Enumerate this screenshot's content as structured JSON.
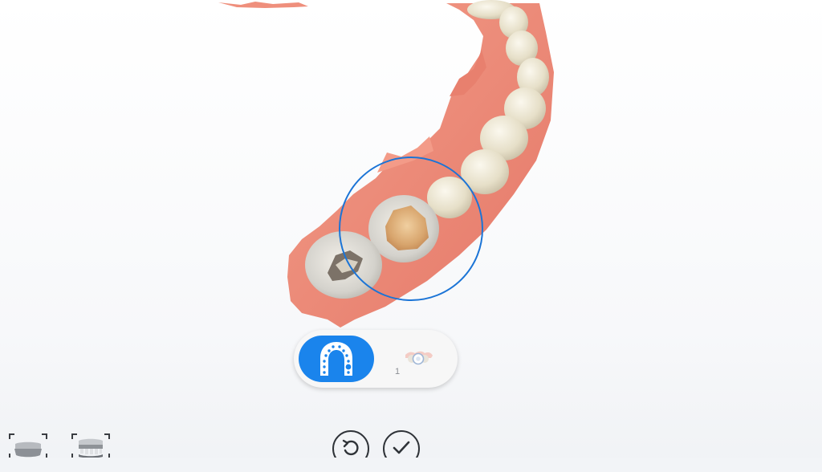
{
  "toolbar": {
    "active_mode": "upper-jaw-scan",
    "secondary_mode_count": "1"
  },
  "bottom_bar": {
    "left_icons": [
      "lower-jaw-view-icon",
      "upper-jaw-view-icon"
    ],
    "center_buttons": [
      "undo-button",
      "confirm-button"
    ]
  },
  "colors": {
    "accent": "#1a84ec",
    "gum": "#ec8a78",
    "tooth": "#ece6d2",
    "selection_ring": "#1b74d6"
  }
}
